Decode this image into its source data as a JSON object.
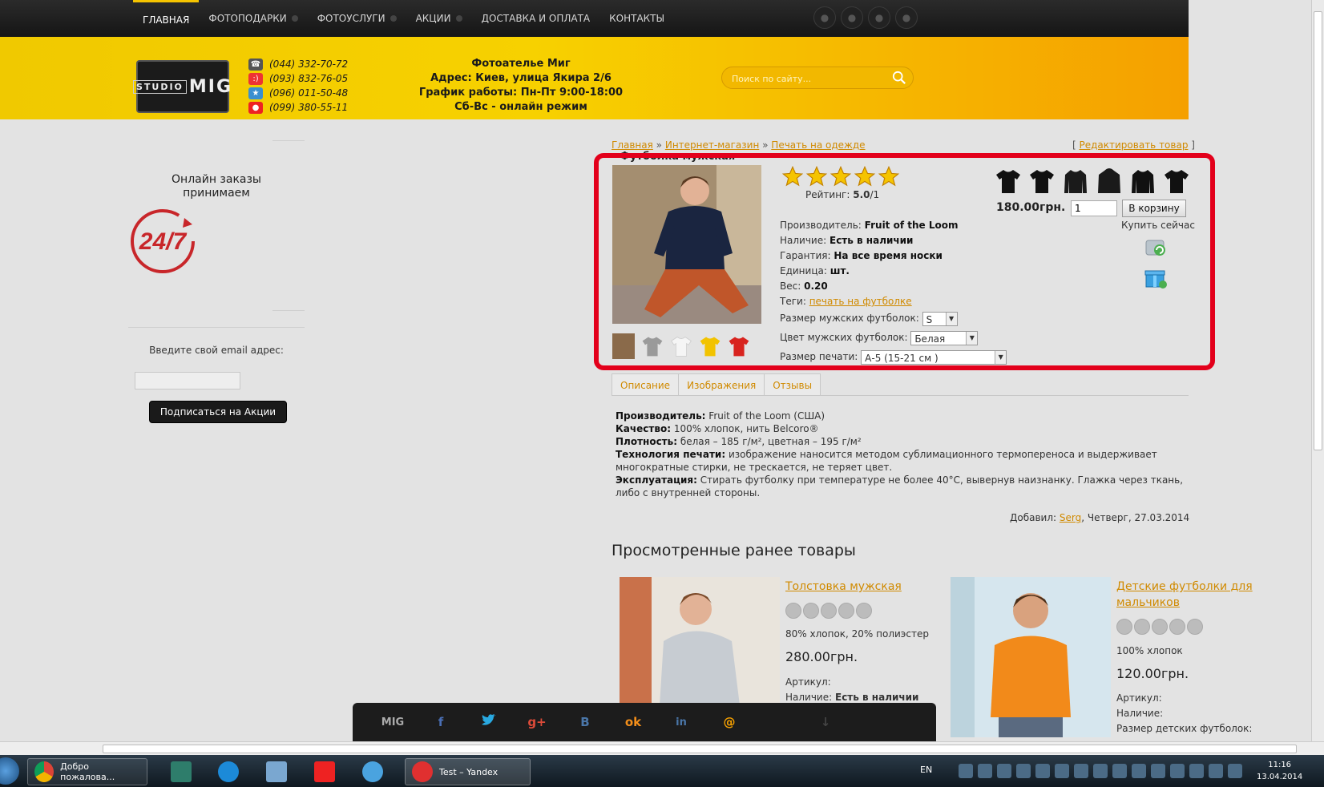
{
  "topnav": {
    "items": [
      "ГЛАВНАЯ",
      "ФОТОПОДАРКИ",
      "ФОТОУСЛУГИ",
      "АКЦИИ",
      "ДОСТАВКА И ОПЛАТА",
      "КОНТАКТЫ"
    ]
  },
  "header": {
    "logo": {
      "main": "MIG",
      "sub": "STUDIO"
    },
    "phones": [
      "(044) 332-70-72",
      "(093) 832-76-05",
      "(096) 011-50-48",
      "(099) 380-55-11"
    ],
    "contact": [
      "Фотоателье Миг",
      "Адрес: Киев, улица Якира 2/6",
      "График работы: Пн-Пт 9:00-18:00",
      "Сб-Вс - онлайн режим"
    ],
    "search_placeholder": "Поиск по сайту..."
  },
  "sidebar": {
    "online_line1": "Онлайн заказы",
    "online_line2": "принимаем",
    "badge": "24/7",
    "email_label": "Введите свой email адрес:",
    "subscribe_button": "Подписаться на Акции"
  },
  "breadcrumb": {
    "items": [
      "Главная",
      "Интернет-магазин",
      "Печать на одежде"
    ],
    "separator": "»",
    "edit_link": "Редактировать товар"
  },
  "product": {
    "title": "Футболка мужская",
    "rating_label": "Рейтинг:",
    "rating_value": "5.0",
    "rating_count": "1",
    "specs": {
      "manufacturer_label": "Производитель:",
      "manufacturer": "Fruit of the Loom",
      "availability_label": "Наличие:",
      "availability": "Есть в наличии",
      "warranty_label": "Гарантия:",
      "warranty": "На все время носки",
      "unit_label": "Единица:",
      "unit": "шт.",
      "weight_label": "Вес:",
      "weight": "0.20",
      "tags_label": "Теги:",
      "tags": "печать на футболке",
      "size_label": "Размер мужских футболок:",
      "size_value": "S",
      "color_label": "Цвет мужских футболок:",
      "color_value": "Белая",
      "print_size_label": "Размер печати:",
      "print_size_value": "А-5 (15-21 см )"
    },
    "price": "180.00грн.",
    "qty": "1",
    "cart_button": "В корзину",
    "buy_now": "Купить сейчас"
  },
  "tabs": [
    "Описание",
    "Изображения",
    "Отзывы"
  ],
  "description": {
    "lines": [
      {
        "label": "Производитель:",
        "text": " Fruit of the Loom (США)"
      },
      {
        "label": "Качество:",
        "text": " 100% хлопок, нить Belcoro®"
      },
      {
        "label": "Плотность:",
        "text": " белая – 185 г/м², цветная – 195 г/м²"
      },
      {
        "label": "Технология печати:",
        "text": " изображение наносится методом сублимационного термопереноса и выдерживает многократные стирки, не трескается, не теряет цвет."
      },
      {
        "label": "Эксплуатация:",
        "text": " Стирать футболку при температуре не более 40°С, вывернув наизнанку. Глажка через ткань, либо с внутренней стороны."
      }
    ],
    "added_label": "Добавил:",
    "added_by": "Serg",
    "added_date": ", Четверг, 27.03.2014"
  },
  "viewed": {
    "title": "Просмотренные ранее товары",
    "items": [
      {
        "name": "Толстовка мужская",
        "material": "80% хлопок, 20% полиэстер",
        "price": "280.00грн.",
        "article_label": "Артикул:",
        "availability_label": "Наличие:",
        "availability": "Есть в наличии"
      },
      {
        "name": "Детские футболки для мальчиков",
        "material": "100% хлопок",
        "price": "120.00грн.",
        "article_label": "Артикул:",
        "availability_label": "Наличие:",
        "size_label": "Размер детских футболок:"
      }
    ]
  },
  "sharebar": [
    "MIG",
    "f",
    "t",
    "g+",
    "B",
    "ok",
    "in",
    "@",
    "↓"
  ],
  "taskbar": {
    "task1": "Добро пожалова...",
    "task2": "Test – Yandex",
    "lang": "EN",
    "time": "11:16",
    "date": "13.04.2014"
  },
  "colors": {
    "accent": "#f5c400",
    "link": "#d08a00",
    "highlight": "#e3001b"
  }
}
